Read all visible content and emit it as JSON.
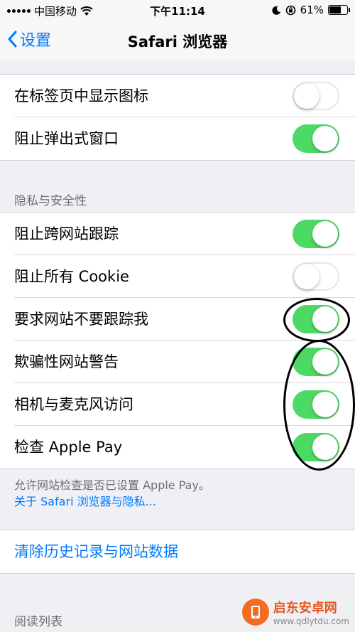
{
  "status_bar": {
    "carrier": "中国移动",
    "time": "下午11:14",
    "battery_percent": "61%",
    "battery_level": 0.61
  },
  "nav": {
    "back_label": "设置",
    "title": "Safari 浏览器"
  },
  "settings": {
    "show_icons_in_tabs": {
      "label": "在标签页中显示图标",
      "on": false
    },
    "block_popups": {
      "label": "阻止弹出式窗口",
      "on": true
    }
  },
  "privacy": {
    "header": "隐私与安全性",
    "items": [
      {
        "label": "阻止跨网站跟踪",
        "on": true
      },
      {
        "label": "阻止所有 Cookie",
        "on": false
      },
      {
        "label": "要求网站不要跟踪我",
        "on": true
      },
      {
        "label": "欺骗性网站警告",
        "on": true
      },
      {
        "label": "相机与麦克风访问",
        "on": true
      },
      {
        "label": "检查 Apple Pay",
        "on": true
      }
    ],
    "footer": "允许网站检查是否已设置 Apple Pay。",
    "footer_link": "关于 Safari 浏览器与隐私..."
  },
  "clear_history": {
    "label": "清除历史记录与网站数据"
  },
  "reading_list": {
    "header": "阅读列表"
  },
  "colors": {
    "accent": "#007aff",
    "toggle_on": "#4cd964",
    "background": "#efeff4"
  },
  "watermark": {
    "name": "启东安卓网",
    "url": "www.qdlytdu.com"
  }
}
